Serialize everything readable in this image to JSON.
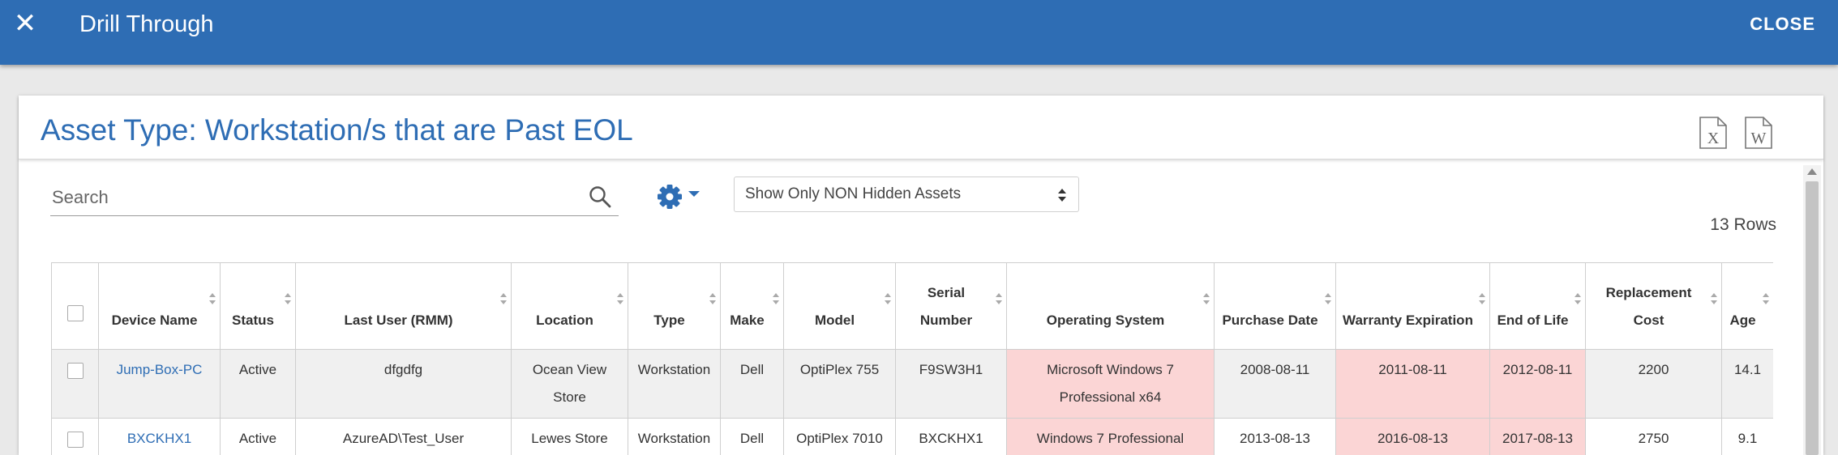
{
  "topbar": {
    "title": "Drill Through",
    "close_label": "CLOSE",
    "color": "#2e6db4"
  },
  "card": {
    "title": "Asset Type: Workstation/s that are Past EOL",
    "excel_icon_letter": "X",
    "word_icon_letter": "W"
  },
  "search": {
    "placeholder": "Search"
  },
  "filter": {
    "selected": "Show Only NON Hidden Assets"
  },
  "row_count": "13 Rows",
  "table": {
    "columns": [
      "",
      "Device Name",
      "Status",
      "Last User (RMM)",
      "Location",
      "Type",
      "Make",
      "Model",
      "Serial Number",
      "Operating System",
      "Purchase Date",
      "Warranty Expiration",
      "End of Life",
      "Replacement Cost",
      "Age"
    ],
    "rows": [
      {
        "device": "Jump-Box-PC",
        "status": "Active",
        "last_user": "dfgdfg",
        "location": "Ocean View Store",
        "type": "Workstation",
        "make": "Dell",
        "model": "OptiPlex 755",
        "serial": "F9SW3H1",
        "os": "Microsoft Windows 7 Professional x64",
        "purchase": "2008-08-11",
        "warranty": "2011-08-11",
        "eol": "2012-08-11",
        "cost": "2200",
        "age": "14.1"
      },
      {
        "device": "BXCKHX1",
        "status": "Active",
        "last_user": "AzureAD\\Test_User",
        "location": "Lewes Store",
        "type": "Workstation",
        "make": "Dell",
        "model": "OptiPlex 7010",
        "serial": "BXCKHX1",
        "os": "Windows 7 Professional",
        "purchase": "2013-08-13",
        "warranty": "2016-08-13",
        "eol": "2017-08-13",
        "cost": "2750",
        "age": "9.1"
      }
    ],
    "highlight_color": "#fbd5d5"
  }
}
